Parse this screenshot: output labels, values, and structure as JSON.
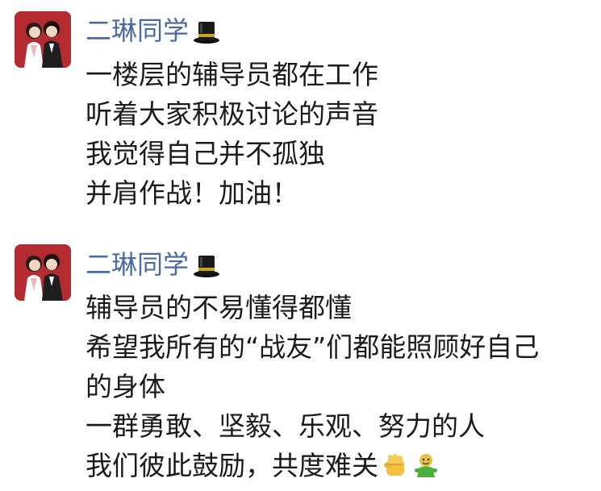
{
  "messages": [
    {
      "sender": "二琳同学",
      "sender_badge_icon": "top-hat",
      "lines": [
        "一楼层的辅导员都在工作",
        "听着大家积极讨论的声音",
        "我觉得自己并不孤独",
        "并肩作战！加油！"
      ]
    },
    {
      "sender": "二琳同学",
      "sender_badge_icon": "top-hat",
      "lines": [
        "辅导员的不易懂得都懂",
        "希望我所有的“战友”们都能照顾好自己",
        "的身体",
        "一群勇敢、坚毅、乐观、努力的人",
        "我们彼此鼓励，共度难关"
      ],
      "trailing_emojis": [
        "raised-fist-emoji",
        "green-figure-emoji"
      ]
    }
  ],
  "colors": {
    "sender_name": "#4b6aa0",
    "text": "#1b1b1b",
    "avatar_bg": "#b52b32"
  }
}
